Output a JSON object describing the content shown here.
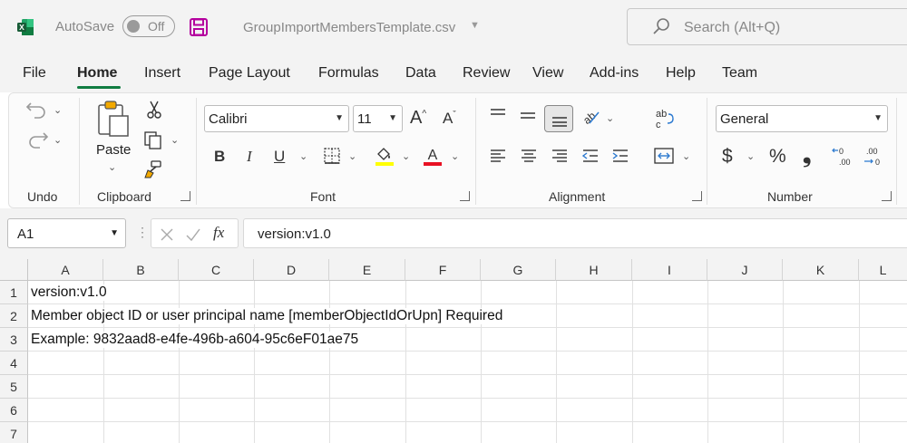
{
  "titlebar": {
    "autosave_label": "AutoSave",
    "autosave_state": "Off",
    "filename": "GroupImportMembersTemplate.csv",
    "search_placeholder": "Search (Alt+Q)"
  },
  "tabs": [
    "File",
    "Home",
    "Insert",
    "Page Layout",
    "Formulas",
    "Data",
    "Review",
    "View",
    "Add-ins",
    "Help",
    "Team"
  ],
  "active_tab": "Home",
  "ribbon": {
    "groups": {
      "undo": "Undo",
      "clipboard": "Clipboard",
      "font": "Font",
      "alignment": "Alignment",
      "number": "Number"
    },
    "paste_label": "Paste",
    "font_name": "Calibri",
    "font_size": "11",
    "number_format": "General",
    "bold": "B",
    "italic": "I",
    "underline": "U",
    "currency": "$",
    "percent": "%",
    "comma": "❟",
    "font_color": "#e81123",
    "highlight_color": "#ffff00",
    "accent": "#107c41"
  },
  "formula_bar": {
    "name_box": "A1",
    "fx": "fx",
    "value": "version:v1.0"
  },
  "grid": {
    "columns": [
      "A",
      "B",
      "C",
      "D",
      "E",
      "F",
      "G",
      "H",
      "I",
      "J",
      "K",
      "L"
    ],
    "rows": [
      "1",
      "2",
      "3",
      "4",
      "5",
      "6",
      "7"
    ],
    "cells": {
      "A1": "version:v1.0",
      "A2": "Member object ID or user principal name [memberObjectIdOrUpn] Required",
      "A3": "Example: 9832aad8-e4fe-496b-a604-95c6eF01ae75"
    }
  }
}
